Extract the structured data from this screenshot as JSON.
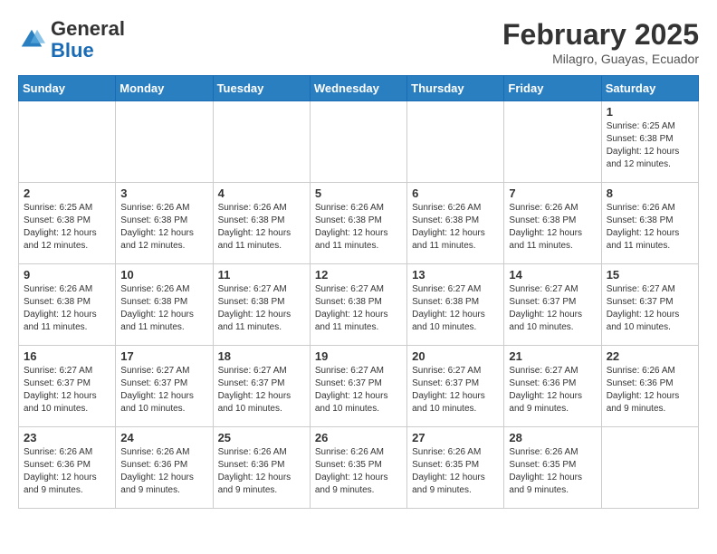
{
  "logo": {
    "general": "General",
    "blue": "Blue"
  },
  "header": {
    "month": "February 2025",
    "location": "Milagro, Guayas, Ecuador"
  },
  "days_of_week": [
    "Sunday",
    "Monday",
    "Tuesday",
    "Wednesday",
    "Thursday",
    "Friday",
    "Saturday"
  ],
  "weeks": [
    [
      {
        "day": "",
        "info": ""
      },
      {
        "day": "",
        "info": ""
      },
      {
        "day": "",
        "info": ""
      },
      {
        "day": "",
        "info": ""
      },
      {
        "day": "",
        "info": ""
      },
      {
        "day": "",
        "info": ""
      },
      {
        "day": "1",
        "info": "Sunrise: 6:25 AM\nSunset: 6:38 PM\nDaylight: 12 hours\nand 12 minutes."
      }
    ],
    [
      {
        "day": "2",
        "info": "Sunrise: 6:25 AM\nSunset: 6:38 PM\nDaylight: 12 hours\nand 12 minutes."
      },
      {
        "day": "3",
        "info": "Sunrise: 6:26 AM\nSunset: 6:38 PM\nDaylight: 12 hours\nand 12 minutes."
      },
      {
        "day": "4",
        "info": "Sunrise: 6:26 AM\nSunset: 6:38 PM\nDaylight: 12 hours\nand 11 minutes."
      },
      {
        "day": "5",
        "info": "Sunrise: 6:26 AM\nSunset: 6:38 PM\nDaylight: 12 hours\nand 11 minutes."
      },
      {
        "day": "6",
        "info": "Sunrise: 6:26 AM\nSunset: 6:38 PM\nDaylight: 12 hours\nand 11 minutes."
      },
      {
        "day": "7",
        "info": "Sunrise: 6:26 AM\nSunset: 6:38 PM\nDaylight: 12 hours\nand 11 minutes."
      },
      {
        "day": "8",
        "info": "Sunrise: 6:26 AM\nSunset: 6:38 PM\nDaylight: 12 hours\nand 11 minutes."
      }
    ],
    [
      {
        "day": "9",
        "info": "Sunrise: 6:26 AM\nSunset: 6:38 PM\nDaylight: 12 hours\nand 11 minutes."
      },
      {
        "day": "10",
        "info": "Sunrise: 6:26 AM\nSunset: 6:38 PM\nDaylight: 12 hours\nand 11 minutes."
      },
      {
        "day": "11",
        "info": "Sunrise: 6:27 AM\nSunset: 6:38 PM\nDaylight: 12 hours\nand 11 minutes."
      },
      {
        "day": "12",
        "info": "Sunrise: 6:27 AM\nSunset: 6:38 PM\nDaylight: 12 hours\nand 11 minutes."
      },
      {
        "day": "13",
        "info": "Sunrise: 6:27 AM\nSunset: 6:38 PM\nDaylight: 12 hours\nand 10 minutes."
      },
      {
        "day": "14",
        "info": "Sunrise: 6:27 AM\nSunset: 6:37 PM\nDaylight: 12 hours\nand 10 minutes."
      },
      {
        "day": "15",
        "info": "Sunrise: 6:27 AM\nSunset: 6:37 PM\nDaylight: 12 hours\nand 10 minutes."
      }
    ],
    [
      {
        "day": "16",
        "info": "Sunrise: 6:27 AM\nSunset: 6:37 PM\nDaylight: 12 hours\nand 10 minutes."
      },
      {
        "day": "17",
        "info": "Sunrise: 6:27 AM\nSunset: 6:37 PM\nDaylight: 12 hours\nand 10 minutes."
      },
      {
        "day": "18",
        "info": "Sunrise: 6:27 AM\nSunset: 6:37 PM\nDaylight: 12 hours\nand 10 minutes."
      },
      {
        "day": "19",
        "info": "Sunrise: 6:27 AM\nSunset: 6:37 PM\nDaylight: 12 hours\nand 10 minutes."
      },
      {
        "day": "20",
        "info": "Sunrise: 6:27 AM\nSunset: 6:37 PM\nDaylight: 12 hours\nand 10 minutes."
      },
      {
        "day": "21",
        "info": "Sunrise: 6:27 AM\nSunset: 6:36 PM\nDaylight: 12 hours\nand 9 minutes."
      },
      {
        "day": "22",
        "info": "Sunrise: 6:26 AM\nSunset: 6:36 PM\nDaylight: 12 hours\nand 9 minutes."
      }
    ],
    [
      {
        "day": "23",
        "info": "Sunrise: 6:26 AM\nSunset: 6:36 PM\nDaylight: 12 hours\nand 9 minutes."
      },
      {
        "day": "24",
        "info": "Sunrise: 6:26 AM\nSunset: 6:36 PM\nDaylight: 12 hours\nand 9 minutes."
      },
      {
        "day": "25",
        "info": "Sunrise: 6:26 AM\nSunset: 6:36 PM\nDaylight: 12 hours\nand 9 minutes."
      },
      {
        "day": "26",
        "info": "Sunrise: 6:26 AM\nSunset: 6:35 PM\nDaylight: 12 hours\nand 9 minutes."
      },
      {
        "day": "27",
        "info": "Sunrise: 6:26 AM\nSunset: 6:35 PM\nDaylight: 12 hours\nand 9 minutes."
      },
      {
        "day": "28",
        "info": "Sunrise: 6:26 AM\nSunset: 6:35 PM\nDaylight: 12 hours\nand 9 minutes."
      },
      {
        "day": "",
        "info": ""
      }
    ]
  ]
}
